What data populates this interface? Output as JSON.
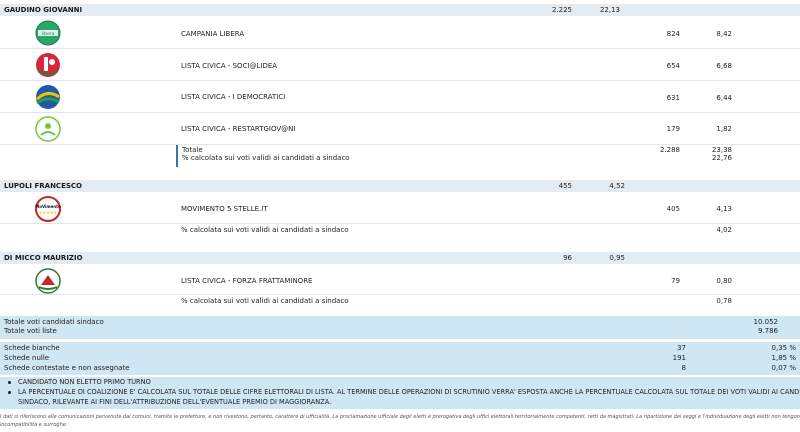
{
  "candidates": [
    {
      "name": "GAUDINO GIOVANNI",
      "votes": "2.225",
      "pct": "22,13",
      "lists": [
        {
          "name": "CAMPANIA LIBERA",
          "votes": "824",
          "pct": "8,42",
          "logo": "campania-libera-logo"
        },
        {
          "name": "LISTA CIVICA - SOCI@LIDEA",
          "votes": "654",
          "pct": "6,68",
          "logo": "socialidea-logo"
        },
        {
          "name": "LISTA CIVICA - I DEMOCRATICI",
          "votes": "631",
          "pct": "6,44",
          "logo": "democratici-logo"
        },
        {
          "name": "LISTA CIVICA - RESTARTGIOV@NI",
          "votes": "179",
          "pct": "1,82",
          "logo": "restartgiovani-logo"
        }
      ],
      "total_label": "Totale",
      "total_votes": "2.288",
      "total_pct": "23,38",
      "pct_label": "% calcolata sui voti validi ai candidati a sindaco",
      "pct_value": "22,76"
    },
    {
      "name": "LUPOLI FRANCESCO",
      "votes": "455",
      "pct": "4,52",
      "lists": [
        {
          "name": "MOVIMENTO 5 STELLE.IT",
          "votes": "405",
          "pct": "4,13",
          "logo": "movimento5stelle-logo"
        }
      ],
      "pct_label": "% calcolata sui voti validi ai candidati a sindaco",
      "pct_value": "4,02"
    },
    {
      "name": "DI MICCO MAURIZIO",
      "votes": "96",
      "pct": "0,95",
      "lists": [
        {
          "name": "LISTA CIVICA - FORZA FRATTAMINORE",
          "votes": "79",
          "pct": "0,80",
          "logo": "forza-frattaminore-logo"
        }
      ],
      "pct_label": "% calcolata sui voti validi ai candidati a sindaco",
      "pct_value": "0,78"
    }
  ],
  "summary_totals": [
    {
      "label": "Totale voti candidati sindaco",
      "value": "10.052"
    },
    {
      "label": "Totale voti liste",
      "value": "9.786"
    }
  ],
  "summary_ballots": [
    {
      "label": "Schede bianche",
      "value": "37",
      "pct": "0,35 %"
    },
    {
      "label": "Schede nulle",
      "value": "191",
      "pct": "1,85 %"
    },
    {
      "label": "Schede contestate e non assegnate",
      "value": "8",
      "pct": "0,07 %"
    }
  ],
  "notes": [
    "CANDIDATO NON ELETTO PRIMO TURNO",
    "LA PERCENTUALE DI COALIZIONE E' CALCOLATA SUL TOTALE DELLE CIFRE ELETTORALI DI LISTA. AL TERMINE DELLE OPERAZIONI DI SCRUTINIO VERRA' ESPOSTA ANCHE LA PERCENTUALE CALCOLATA SUL TOTALE DEI VOTI VALIDI AI CANDIDATI",
    "SINDACO, RILEVANTE AI FINI DELL'ATTRIBUZIONE DELL'EVENTUALE PREMIO DI MAGGIORANZA."
  ],
  "footer": [
    "I dati si riferiscono alle comunicazioni pervenute dai comuni, tramite le prefetture, e non rivestono, pertanto, carattere di ufficialità. La proclamazione ufficiale degli eletti è prerogativa degli uffici elettorali territorialmente competenti, retti da magistrati. La ripartizione dei seggi e l'individuazione degli eletti non tengono conto di eventuali \"opzioni\",",
    "incompatibilità e surroghe."
  ],
  "colors": {
    "header_bar": "#e3ecf3",
    "summary_bg": "#cfe6f4",
    "accent": "#2f7aa6"
  }
}
